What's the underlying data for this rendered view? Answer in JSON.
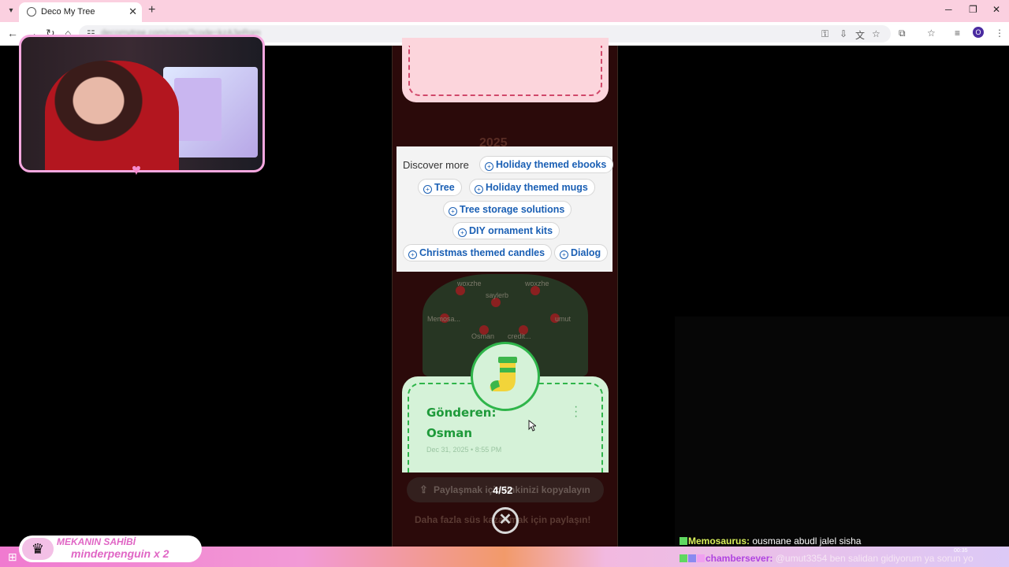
{
  "browser": {
    "tab_title": "Deco My Tree",
    "url": "decomytree.com/room/?code=kzA3eRqm",
    "profile_letter": "O"
  },
  "page": {
    "year": "2025",
    "discover": {
      "label": "Discover more",
      "chips": [
        "Holiday themed ebooks",
        "Tree",
        "Holiday themed mugs",
        "Tree storage solutions",
        "DIY ornament kits",
        "Christmas themed candles",
        "Dialog"
      ]
    },
    "tree_labels": [
      "woxzhe",
      "woxzhe",
      "saylerb",
      "Memosa...",
      "umut",
      "Osman",
      "credit..."
    ],
    "message": {
      "sender_label": "Gönderen:",
      "sender_name": "Osman",
      "date": "Dec 31, 2025 • 8:55 PM"
    },
    "share_button": "Paylaşmak için linkinizi kopyalayın",
    "counter": "4/52",
    "share_more": "Daha fazla süs kazanmak için paylaşın!"
  },
  "overlay": {
    "owner_title": "MEKANIN SAHİBİ",
    "owner_name": "minderpenguin x 2",
    "chat": [
      {
        "user": "Memosaurus:",
        "message": "ousmane abudl jalel sisha"
      },
      {
        "user": "chambersever:",
        "message": "@umut3354 ben salidan gidiyorum ya sorun yo"
      }
    ],
    "clock": "00:35"
  },
  "colors": {
    "tabbar": "#fbd0e0",
    "card_green": "#d5f2d8",
    "card_pink": "#fcd5dc",
    "link_blue": "#1a5fb4"
  }
}
